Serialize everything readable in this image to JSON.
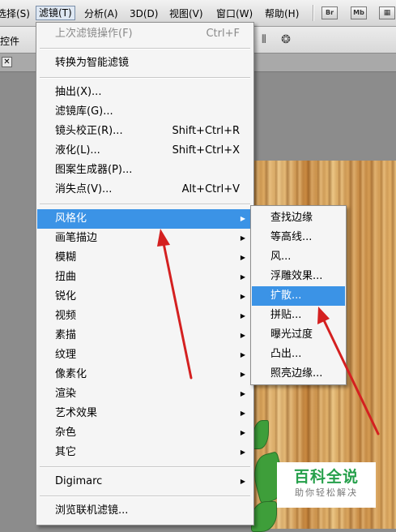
{
  "menubar": {
    "items": [
      "选择(S)",
      "滤镜(T)",
      "分析(A)",
      "3D(D)",
      "视图(V)",
      "窗口(W)",
      "帮助(H)"
    ],
    "badges": [
      "Br",
      "Mb"
    ]
  },
  "options_bar": {
    "label": "控件"
  },
  "filter_menu": {
    "last_filter": {
      "label": "上次滤镜操作(F)",
      "shortcut": "Ctrl+F"
    },
    "smart": {
      "label": "转换为智能滤镜"
    },
    "group1": [
      {
        "label": "抽出(X)...",
        "shortcut": ""
      },
      {
        "label": "滤镜库(G)...",
        "shortcut": ""
      },
      {
        "label": "镜头校正(R)...",
        "shortcut": "Shift+Ctrl+R"
      },
      {
        "label": "液化(L)...",
        "shortcut": "Shift+Ctrl+X"
      },
      {
        "label": "图案生成器(P)...",
        "shortcut": ""
      },
      {
        "label": "消失点(V)...",
        "shortcut": "Alt+Ctrl+V"
      }
    ],
    "categories": [
      "风格化",
      "画笔描边",
      "模糊",
      "扭曲",
      "锐化",
      "视频",
      "素描",
      "纹理",
      "像素化",
      "渲染",
      "艺术效果",
      "杂色",
      "其它"
    ],
    "digimarc": "Digimarc",
    "browse": "浏览联机滤镜..."
  },
  "stylize_submenu": {
    "items": [
      "查找边缘",
      "等高线...",
      "风...",
      "浮雕效果...",
      "扩散...",
      "拼贴...",
      "曝光过度",
      "凸出...",
      "照亮边缘..."
    ]
  },
  "watermark": {
    "main": "百科全说",
    "sub": "助你轻松解决"
  },
  "colors": {
    "highlight": "#3b93e6",
    "menu_bg": "#f5f5f5",
    "arrow": "#d42020",
    "watermark_green": "#26a04b"
  }
}
